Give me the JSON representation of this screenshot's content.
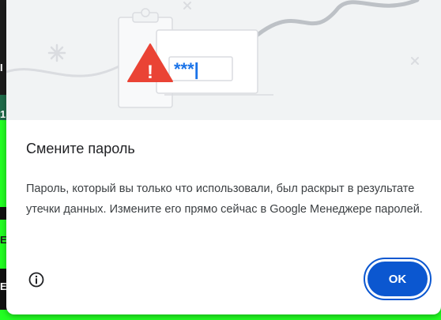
{
  "dialog": {
    "title": "Смените пароль",
    "message": "Пароль, который вы только что использовали, был раскрыт в результате утечки данных. Измените его прямо сейчас в Google Менеджере паролей.",
    "ok_label": "OK",
    "info_icon": "info-icon",
    "illustration": {
      "password_mask": "***|",
      "warning_mark": "!"
    }
  },
  "background": {
    "edge_chars": [
      "I",
      "1",
      "E",
      "E"
    ]
  },
  "colors": {
    "accent": "#0b57d0",
    "warning": "#ea4335",
    "password_blue": "#1a73e8",
    "hero_bg": "#f1f3f4",
    "bg_green": "#22ff22"
  }
}
